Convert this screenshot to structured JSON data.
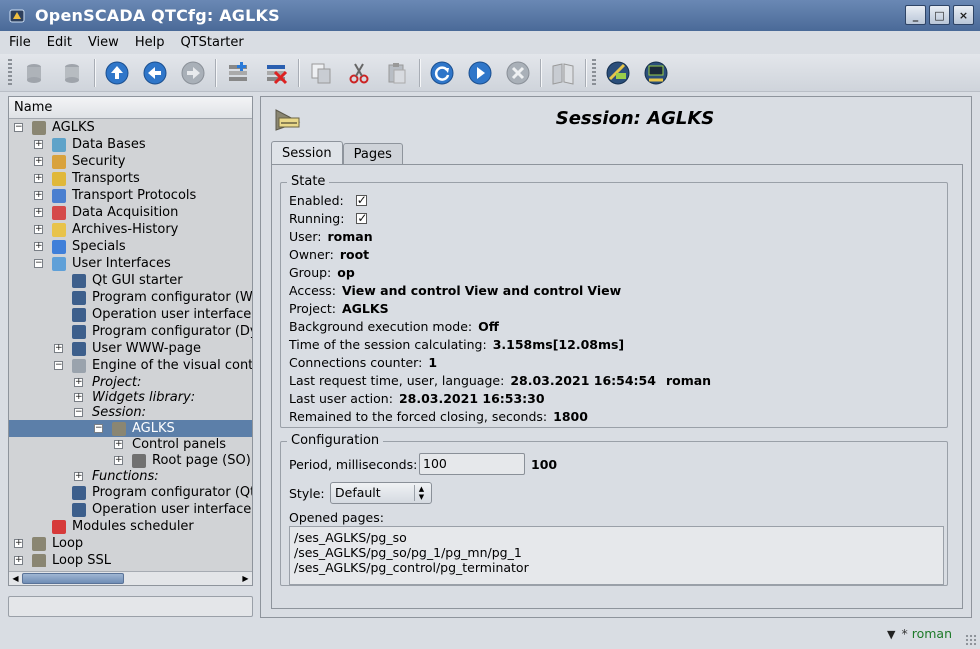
{
  "window": {
    "title": "OpenSCADA QTCfg: AGLKS",
    "buttons": [
      "_",
      "□",
      "×"
    ]
  },
  "menu": [
    "File",
    "Edit",
    "View",
    "Help",
    "QTStarter"
  ],
  "toolbar": {
    "buttons": [
      "db-load",
      "db-save",
      "up",
      "back",
      "forward",
      "add-item",
      "delete-item",
      "copy",
      "cut",
      "paste",
      "reload",
      "start",
      "stop",
      "manual",
      "qtstarter-1",
      "qtstarter-2"
    ]
  },
  "tree": {
    "header": "Name",
    "items": [
      {
        "label": "AGLKS",
        "exp": "−",
        "icon": "#8a8672"
      },
      {
        "label": "Data Bases",
        "exp": "+",
        "icon": "#5fa3c9"
      },
      {
        "label": "Security",
        "exp": "+",
        "icon": "#d9a23c"
      },
      {
        "label": "Transports",
        "exp": "+",
        "icon": "#e0b83a"
      },
      {
        "label": "Transport Protocols",
        "exp": "+",
        "icon": "#4a7fd0"
      },
      {
        "label": "Data Acquisition",
        "exp": "+",
        "icon": "#d54a4a"
      },
      {
        "label": "Archives-History",
        "exp": "+",
        "icon": "#e8c34a"
      },
      {
        "label": "Specials",
        "exp": "+",
        "icon": "#3f7fd9"
      },
      {
        "label": "User Interfaces",
        "exp": "−",
        "icon": "#5fa0d8"
      },
      {
        "label": "Qt GUI starter",
        "exp": "",
        "icon": "#3d5f8c"
      },
      {
        "label": "Program configurator (WEB",
        "exp": "",
        "icon": "#3d5f8c"
      },
      {
        "label": "Operation user interface (C",
        "exp": "",
        "icon": "#3d5f8c"
      },
      {
        "label": "Program configurator (Dyn",
        "exp": "",
        "icon": "#3d5f8c"
      },
      {
        "label": "User WWW-page",
        "exp": "+",
        "icon": "#3d5f8c"
      },
      {
        "label": "Engine of the visual contro",
        "exp": "−",
        "icon": "#9aa3ad"
      },
      {
        "label": "Project:",
        "exp": "+",
        "icon": "",
        "italic": true
      },
      {
        "label": "Widgets library:",
        "exp": "+",
        "icon": "",
        "italic": true
      },
      {
        "label": "Session:",
        "exp": "−",
        "icon": "",
        "italic": true
      },
      {
        "label": "AGLKS",
        "exp": "−",
        "icon": "#8a8672",
        "selected": true
      },
      {
        "label": "Control panels",
        "exp": "+",
        "icon": ""
      },
      {
        "label": "Root page (SO)",
        "exp": "+",
        "icon": "#707070"
      },
      {
        "label": "Functions:",
        "exp": "+",
        "icon": "",
        "italic": true
      },
      {
        "label": "Program configurator (Qt)",
        "exp": "",
        "icon": "#3d5f8c"
      },
      {
        "label": "Operation user interface (V",
        "exp": "",
        "icon": "#3d5f8c"
      },
      {
        "label": "Modules scheduler",
        "exp": "",
        "icon": "#d63a3a"
      },
      {
        "label": "Loop",
        "exp": "+",
        "icon": "#8a8672"
      },
      {
        "label": "Loop SSL",
        "exp": "+",
        "icon": "#8a8672"
      }
    ]
  },
  "session": {
    "title": "Session: AGLKS",
    "tabs": [
      "Session",
      "Pages"
    ],
    "state": {
      "group_title": "State",
      "enabled_label": "Enabled:",
      "running_label": "Running:",
      "user_label": "User:",
      "user": "roman",
      "owner_label": "Owner:",
      "owner": "root",
      "group_label": "Group:",
      "group": "op",
      "access_label": "Access:",
      "access": [
        "View and control",
        "View and control",
        "View"
      ],
      "project_label": "Project:",
      "project": "AGLKS",
      "bgmode_label": "Background execution mode:",
      "bgmode": "Off",
      "calc_label": "Time of the session calculating:",
      "calc": "3.158ms[12.08ms]",
      "conn_label": "Connections counter:",
      "conn": "1",
      "lastreq_label": "Last request time, user, language:",
      "lastreq": "28.03.2021 16:54:54",
      "lastreq_user": "roman",
      "lastact_label": "Last user action:",
      "lastact": "28.03.2021 16:53:30",
      "remain_label": "Remained to the forced closing, seconds:",
      "remain": "1800"
    },
    "config": {
      "group_title": "Configuration",
      "period_label": "Period, milliseconds:",
      "period_value": "100",
      "period_actual": "100",
      "style_label": "Style:",
      "style_value": "Default",
      "opened_label": "Opened pages:",
      "opened": [
        "/ses_AGLKS/pg_so",
        "/ses_AGLKS/pg_so/pg_1/pg_mn/pg_1",
        "/ses_AGLKS/pg_control/pg_terminator"
      ]
    }
  },
  "status": {
    "user": "roman",
    "star": "*"
  }
}
